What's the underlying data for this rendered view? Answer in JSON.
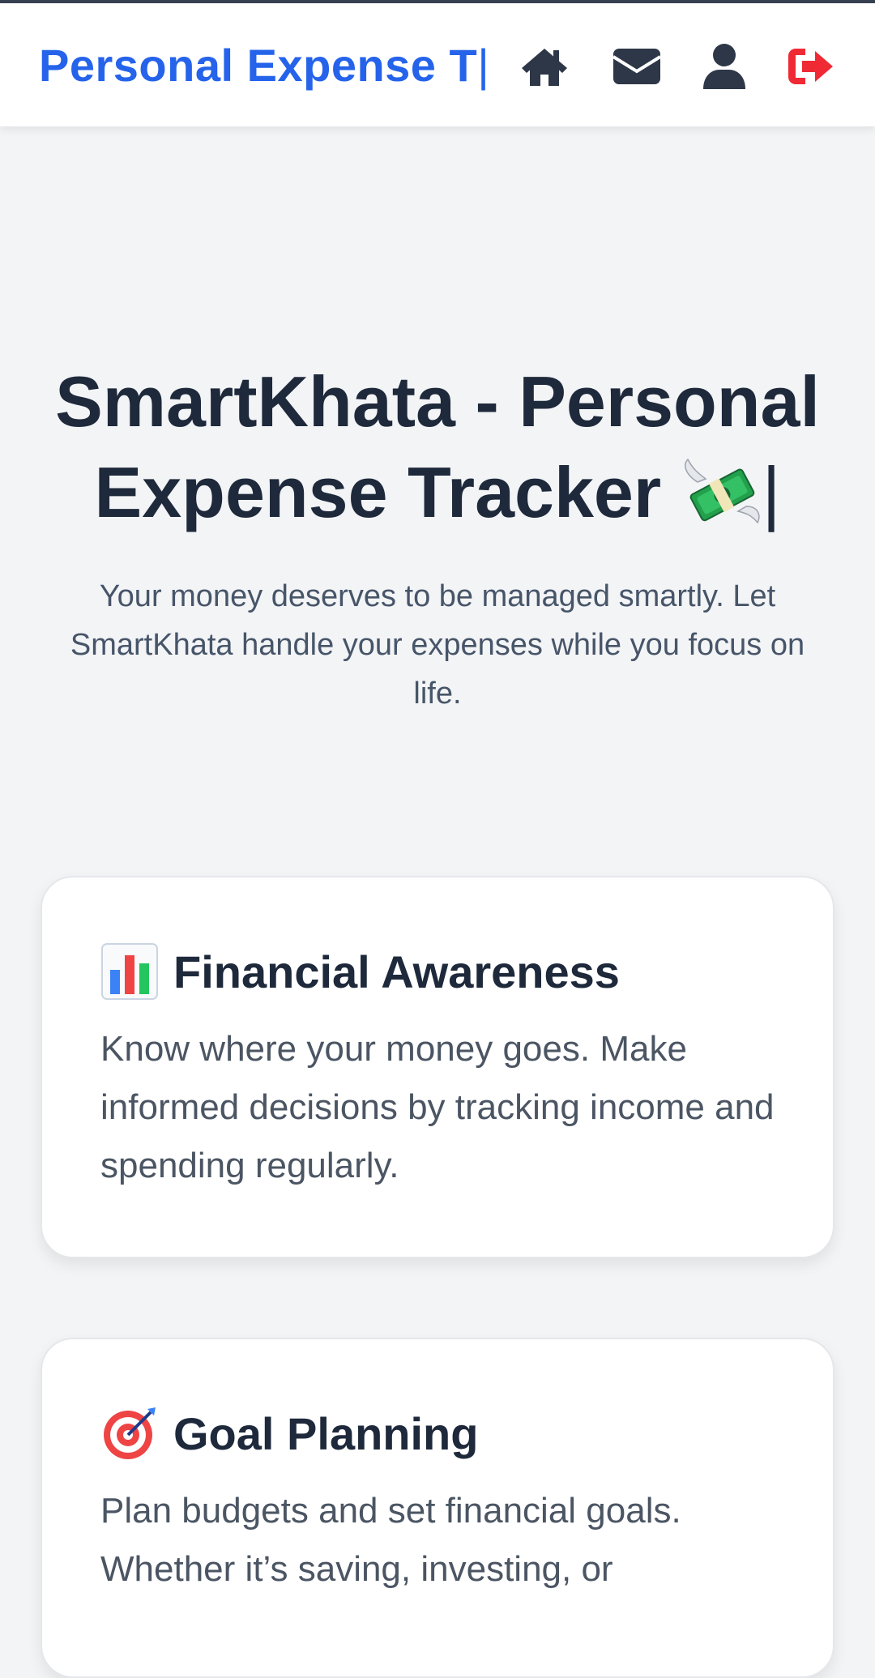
{
  "header": {
    "brand": "Personal Expense T",
    "cursor": "|",
    "icons": [
      "home-icon",
      "envelope-icon",
      "user-icon",
      "sign-out-icon"
    ],
    "logout_color": "#ef2a35",
    "icon_color": "#2d3748",
    "brand_color": "#2563eb"
  },
  "hero": {
    "title": "SmartKhata - Personal Expense Tracker",
    "emoji": "💸",
    "cursor": "|",
    "subtitle": "Your money deserves to be managed smartly. Let SmartKhata handle your expenses while you focus on life."
  },
  "cards": [
    {
      "icon": "bar-chart-emoji",
      "title": "Financial Awareness",
      "text": "Know where your money goes. Make informed decisions by tracking income and spending regularly."
    },
    {
      "icon": "target-emoji",
      "title": "Goal Planning",
      "text": "Plan budgets and set financial goals. Whether it’s saving, investing, or"
    }
  ]
}
